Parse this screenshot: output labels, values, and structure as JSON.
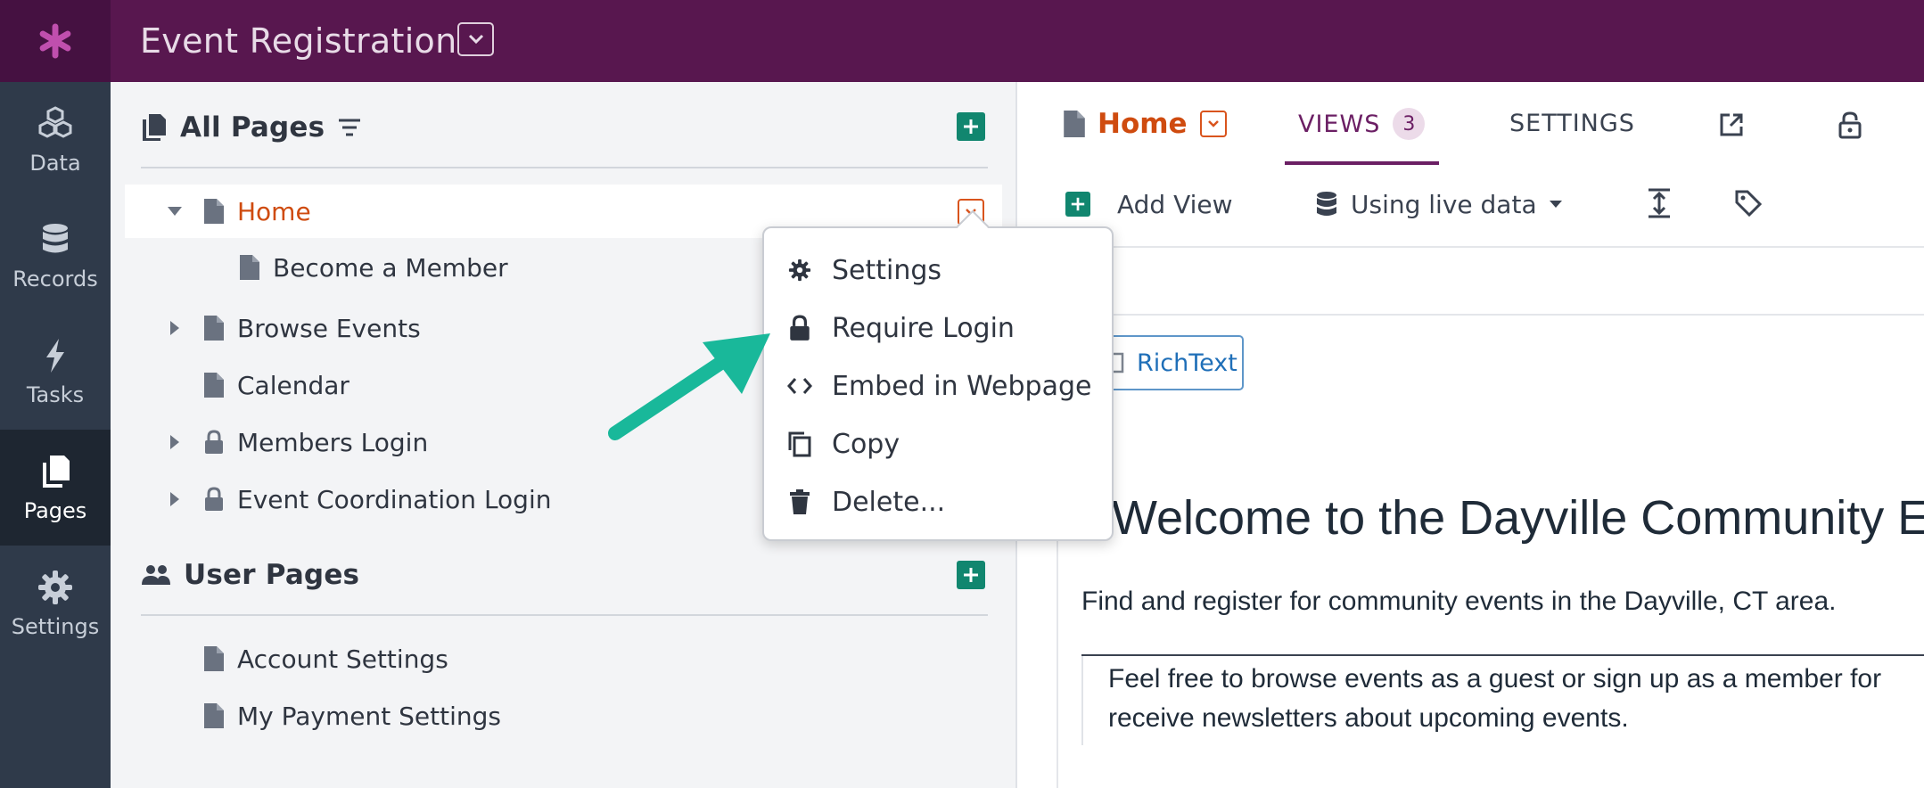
{
  "app": {
    "title": "Event Registration"
  },
  "nav": {
    "items": [
      {
        "label": "Data",
        "icon": "cubes-icon"
      },
      {
        "label": "Records",
        "icon": "database-icon"
      },
      {
        "label": "Tasks",
        "icon": "bolt-icon"
      },
      {
        "label": "Pages",
        "icon": "pages-icon",
        "active": true
      },
      {
        "label": "Settings",
        "icon": "gear-icon"
      }
    ]
  },
  "pages_panel": {
    "all_pages_title": "All Pages",
    "tree": [
      {
        "label": "Home",
        "selected": true
      },
      {
        "label": "Become a Member"
      },
      {
        "label": "Browse Events"
      },
      {
        "label": "Calendar"
      },
      {
        "label": "Members Login"
      },
      {
        "label": "Event Coordination Login"
      }
    ],
    "user_pages_title": "User Pages",
    "user_pages": [
      {
        "label": "Account Settings"
      },
      {
        "label": "My Payment Settings"
      }
    ]
  },
  "context_menu": {
    "items": [
      {
        "label": "Settings",
        "icon": "gear-icon"
      },
      {
        "label": "Require Login",
        "icon": "lock-icon"
      },
      {
        "label": "Embed in Webpage",
        "icon": "code-icon"
      },
      {
        "label": "Copy",
        "icon": "copy-icon"
      },
      {
        "label": "Delete...",
        "icon": "trash-icon"
      }
    ]
  },
  "editor": {
    "page_title": "Home",
    "tabs": {
      "views": "VIEWS",
      "views_count": "3",
      "settings": "SETTINGS"
    },
    "toolbar": {
      "add_view": "Add View",
      "data_source": "Using live data"
    },
    "richtext_tag": "RichText",
    "content": {
      "heading": "Welcome to the Dayville Community Events",
      "intro": "Find and register for community events in the Dayville, CT area.",
      "quote_line1": "Feel free to browse events as a guest or sign up as a member for",
      "quote_line2": "receive newsletters about upcoming events."
    }
  },
  "colors": {
    "topbar": "#58174f",
    "nav": "#2f3a4a",
    "accent_orange": "#cf4b0f",
    "accent_green": "#11866f",
    "accent_purple": "#6b1f64",
    "annotation_arrow": "#19b89a"
  }
}
